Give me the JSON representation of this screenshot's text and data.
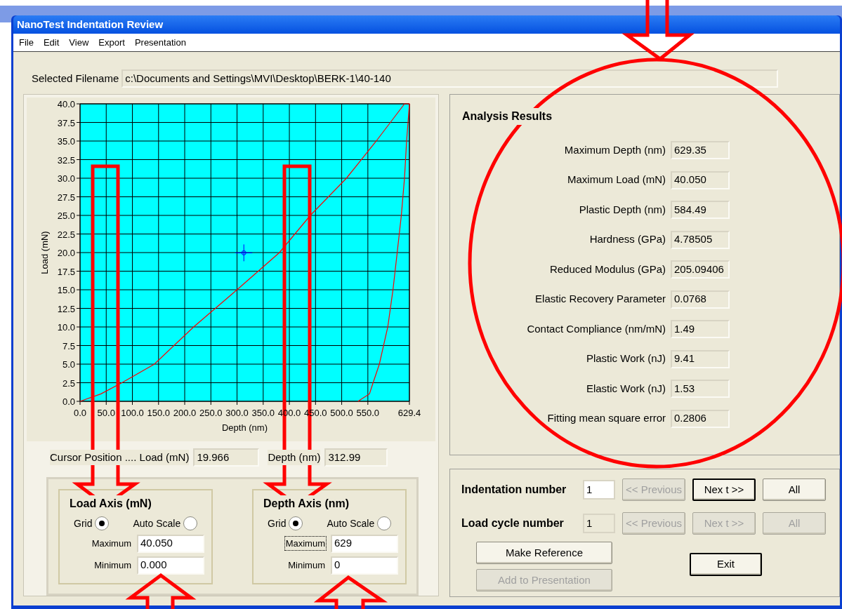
{
  "window": {
    "title": "NanoTest Indentation Review"
  },
  "menu": [
    "File",
    "Edit",
    "View",
    "Export",
    "Presentation"
  ],
  "filename": {
    "label": "Selected Filename",
    "value": "c:\\Documents and Settings\\MVI\\Desktop\\BERK-1\\40-140"
  },
  "chart": {
    "chart_data": {
      "type": "line",
      "grid": true,
      "xlabel": "Depth (nm)",
      "ylabel": "Load (mN)",
      "xlim": [
        0,
        629.4
      ],
      "ylim": [
        0,
        40
      ],
      "x": [
        0,
        40,
        80,
        142,
        217,
        300,
        381,
        440,
        509,
        566,
        620,
        629.4,
        624,
        620,
        614,
        606,
        598,
        588,
        572,
        560,
        553,
        531
      ],
      "series": [
        {
          "color": "#ff0000",
          "values": [
            0,
            1,
            2.5,
            5,
            10,
            15,
            20,
            25,
            30,
            35,
            40,
            40,
            35,
            30,
            25,
            20,
            15,
            10,
            5,
            2.5,
            1,
            0
          ]
        }
      ],
      "xticks": [
        {
          "value": 0,
          "label": "0.0"
        },
        {
          "value": 50,
          "label": "50.0"
        },
        {
          "value": 100,
          "label": "100.0"
        },
        {
          "value": 150,
          "label": "150.0"
        },
        {
          "value": 200,
          "label": "200.0"
        },
        {
          "value": 250,
          "label": "250.0"
        },
        {
          "value": 300,
          "label": "300.0"
        },
        {
          "value": 350,
          "label": "350.0"
        },
        {
          "value": 400,
          "label": "400.0"
        },
        {
          "value": 450,
          "label": "450.0"
        },
        {
          "value": 500,
          "label": "500.0"
        },
        {
          "value": 550,
          "label": "550.0"
        },
        {
          "value": 629.4,
          "label": "629.4"
        }
      ],
      "yticks": [
        {
          "value": 0,
          "label": "0.0"
        },
        {
          "value": 2.5,
          "label": "2.5"
        },
        {
          "value": 5,
          "label": "5.0"
        },
        {
          "value": 7.5,
          "label": "7.5"
        },
        {
          "value": 10,
          "label": "10.0"
        },
        {
          "value": 12.5,
          "label": "12.5"
        },
        {
          "value": 15,
          "label": "15.0"
        },
        {
          "value": 17.5,
          "label": "17.5"
        },
        {
          "value": 20,
          "label": "20.0"
        },
        {
          "value": 22.5,
          "label": "22.5"
        },
        {
          "value": 25,
          "label": "25.0"
        },
        {
          "value": 27.5,
          "label": "27.5"
        },
        {
          "value": 30,
          "label": "30.0"
        },
        {
          "value": 32.5,
          "label": "32.5"
        },
        {
          "value": 35,
          "label": "35.0"
        },
        {
          "value": 37.5,
          "label": "37.5"
        },
        {
          "value": 40,
          "label": "40.0"
        }
      ]
    }
  },
  "cursor": {
    "label": "Cursor Position .... Load (mN)",
    "load": "19.966",
    "depth_label": "Depth (nm)",
    "depth": "312.99"
  },
  "axes": [
    {
      "title": "Load Axis (mN)",
      "options": [
        {
          "label": "Grid",
          "selected": true
        },
        {
          "label": "Auto Scale",
          "selected": false
        }
      ],
      "fields": [
        {
          "label": "Maximum",
          "value": "40.050",
          "focused": false
        },
        {
          "label": "Minimum",
          "value": "0.000",
          "focused": false
        }
      ]
    },
    {
      "title": "Depth Axis (nm)",
      "options": [
        {
          "label": "Grid",
          "selected": true
        },
        {
          "label": "Auto Scale",
          "selected": false
        }
      ],
      "fields": [
        {
          "label": "Maximum",
          "value": "629",
          "focused": true
        },
        {
          "label": "Minimum",
          "value": "0",
          "focused": false
        }
      ]
    }
  ],
  "analysis": {
    "title": "Analysis Results",
    "results": [
      {
        "label": "Maximum Depth (nm)",
        "value": "629.35"
      },
      {
        "label": "Maximum Load (mN)",
        "value": "40.050"
      },
      {
        "label": "Plastic Depth (nm)",
        "value": "584.49"
      },
      {
        "label": "Hardness (GPa)",
        "value": "4.78505"
      },
      {
        "label": "Reduced Modulus (GPa)",
        "value": "205.09406"
      },
      {
        "label": "Elastic Recovery Parameter",
        "value": "0.0768"
      },
      {
        "label": "Contact Compliance (nm/mN)",
        "value": "1.49"
      },
      {
        "label": "Plastic Work (nJ)",
        "value": "9.41"
      },
      {
        "label": "Elastic Work (nJ)",
        "value": "1.53"
      },
      {
        "label": "Fitting mean square error",
        "value": "0.2806"
      }
    ]
  },
  "navigation": [
    {
      "label": "Indentation number",
      "value": "1",
      "disabled": false,
      "buttons": [
        {
          "label": "<< Previous",
          "disabled": true,
          "default": false
        },
        {
          "label": "Nex t >>",
          "disabled": false,
          "default": true
        },
        {
          "label": "All",
          "disabled": false,
          "default": false
        }
      ]
    },
    {
      "label": "Load cycle number",
      "value": "1",
      "disabled": true,
      "buttons": [
        {
          "label": "<< Previous",
          "disabled": true,
          "default": false
        },
        {
          "label": "Nex t >>",
          "disabled": true,
          "default": false
        },
        {
          "label": "All",
          "disabled": true,
          "default": false
        }
      ]
    }
  ],
  "actions": [
    {
      "label": "Make Reference",
      "disabled": false,
      "default": false
    },
    {
      "label": "Add to Presentation",
      "disabled": true,
      "default": false
    }
  ],
  "exit": {
    "label": "Exit",
    "disabled": false,
    "default": true
  }
}
